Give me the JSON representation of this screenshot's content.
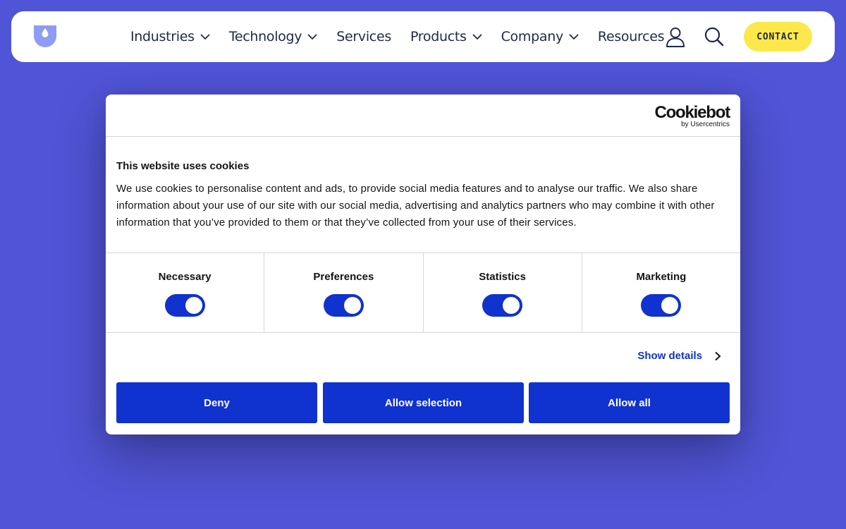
{
  "header": {
    "nav": [
      {
        "label": "Industries",
        "dropdown": true
      },
      {
        "label": "Technology",
        "dropdown": true
      },
      {
        "label": "Services",
        "dropdown": false
      },
      {
        "label": "Products",
        "dropdown": true
      },
      {
        "label": "Company",
        "dropdown": true
      },
      {
        "label": "Resources",
        "dropdown": false
      }
    ],
    "contact_label": "CONTACT",
    "icons": [
      "logo-shield-icon",
      "user-icon",
      "search-icon",
      "chevron-down-icon"
    ]
  },
  "cookie_dialog": {
    "brand_name": "Cookiebot",
    "brand_sub": "by Usercentrics",
    "title": "This website uses cookies",
    "text": "We use cookies to personalise content and ads, to provide social media features and to analyse our traffic. We also share information about your use of our site with our social media, advertising and analytics partners who may combine it with other information that you’ve provided to them or that they’ve collected from your use of their services.",
    "toggles": [
      {
        "label": "Necessary",
        "enabled": true
      },
      {
        "label": "Preferences",
        "enabled": true
      },
      {
        "label": "Statistics",
        "enabled": true
      },
      {
        "label": "Marketing",
        "enabled": true
      }
    ],
    "show_details_label": "Show details",
    "buttons": {
      "deny": "Deny",
      "allow_selection": "Allow selection",
      "allow_all": "Allow all"
    }
  },
  "colors": {
    "page_background": "#5054d6",
    "accent_blue": "#1032cf",
    "contact_yellow": "#fde84b",
    "logo_periwinkle": "#8f9cf4"
  }
}
